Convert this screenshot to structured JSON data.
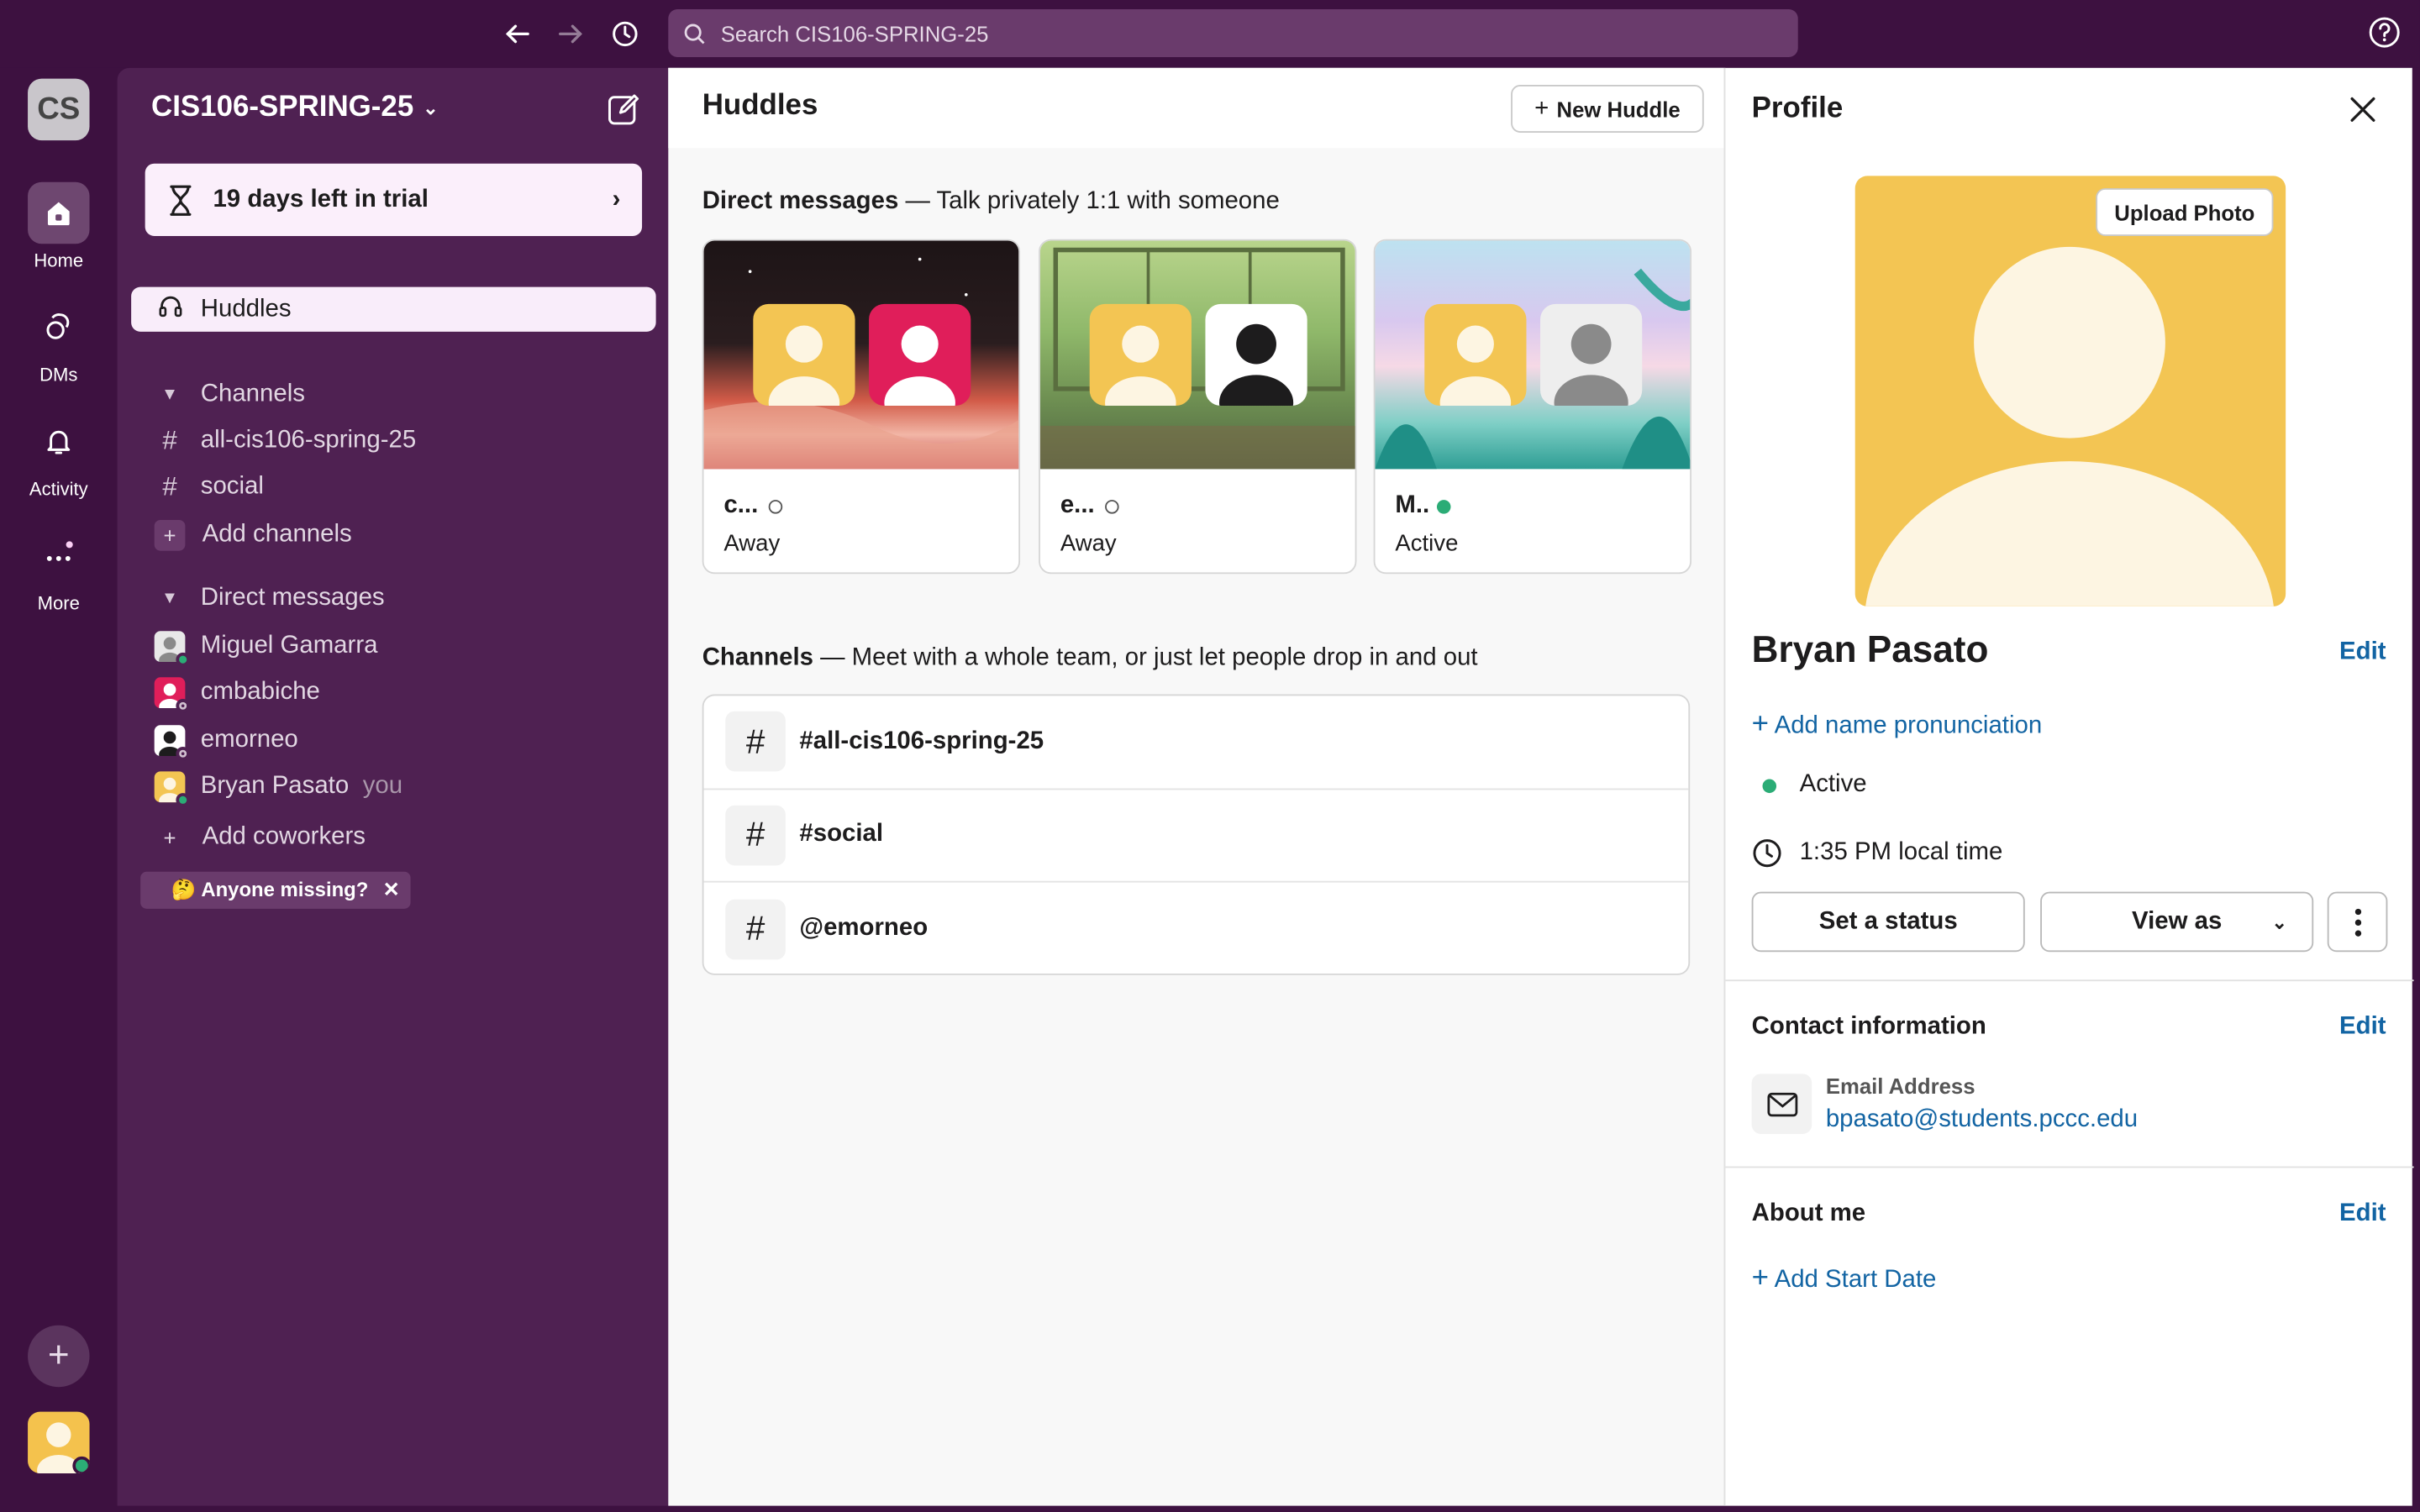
{
  "search": {
    "placeholder": "Search CIS106-SPRING-25"
  },
  "rail": {
    "workspace_initials": "CS",
    "items": [
      {
        "label": "Home"
      },
      {
        "label": "DMs"
      },
      {
        "label": "Activity"
      },
      {
        "label": "More"
      }
    ]
  },
  "sidebar": {
    "workspace_name": "CIS106-SPRING-25",
    "trial_text": "19 days left in trial",
    "huddles_label": "Huddles",
    "channels_header": "Channels",
    "channels": [
      "all-cis106-spring-25",
      "social"
    ],
    "add_channels": "Add channels",
    "dm_header": "Direct messages",
    "dms": [
      {
        "name": "Miguel Gamarra",
        "status": "active",
        "color": "#8a8a8a"
      },
      {
        "name": "cmbabiche",
        "status": "away",
        "color": "#e01e5a"
      },
      {
        "name": "emorneo",
        "status": "away",
        "color": "#1d1c1d"
      },
      {
        "name": "Bryan Pasato",
        "status": "active",
        "color": "#f3c553",
        "suffix": "you"
      }
    ],
    "add_coworkers": "Add coworkers",
    "anyone_missing": "🤔 Anyone missing?"
  },
  "main": {
    "title": "Huddles",
    "new_huddle": "New Huddle",
    "dm_section": {
      "bold": "Direct messages",
      "rest": " — Talk privately 1:1 with someone"
    },
    "cards": [
      {
        "name": "c...",
        "status": "Away",
        "indicator": "away",
        "bg": "space",
        "second_avatar_color": "#e01e5a"
      },
      {
        "name": "e...",
        "status": "Away",
        "indicator": "away",
        "bg": "room",
        "second_avatar_color": "#1d1c1d"
      },
      {
        "name": "M..",
        "status": "Active",
        "indicator": "active",
        "bg": "jungle",
        "second_avatar_color": "#8a8a8a"
      }
    ],
    "channels_section": {
      "bold": "Channels",
      "rest": " — Meet with a whole team, or just let people drop in and out"
    },
    "channel_rows": [
      "#all-cis106-spring-25",
      "#social",
      "@emorneo"
    ]
  },
  "profile": {
    "title": "Profile",
    "upload_photo": "Upload Photo",
    "name": "Bryan Pasato",
    "edit": "Edit",
    "add_pronunciation": "Add name pronunciation",
    "status": "Active",
    "local_time": "1:35 PM local time",
    "set_status": "Set a status",
    "view_as": "View as",
    "contact_title": "Contact information",
    "email_label": "Email Address",
    "email": "bpasato@students.pccc.edu",
    "about_title": "About me",
    "add_start_date": "Add Start Date"
  },
  "colors": {
    "aubergine": "#3d1140",
    "sidebar": "#4f2152",
    "link": "#1264a3",
    "active_green": "#2bac76",
    "avatar_yellow": "#f3c553"
  }
}
